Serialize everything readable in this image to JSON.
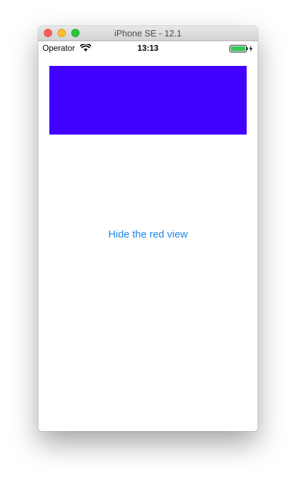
{
  "window": {
    "title": "iPhone SE - 12.1"
  },
  "status_bar": {
    "carrier": "Operator",
    "time": "13:13",
    "wifi_icon": "wifi-icon",
    "battery_icon": "battery-charging-icon",
    "battery_color": "#35c759"
  },
  "content": {
    "view_color": "#4100ff",
    "button_label": "Hide the red view",
    "button_color": "#1b87e8"
  }
}
